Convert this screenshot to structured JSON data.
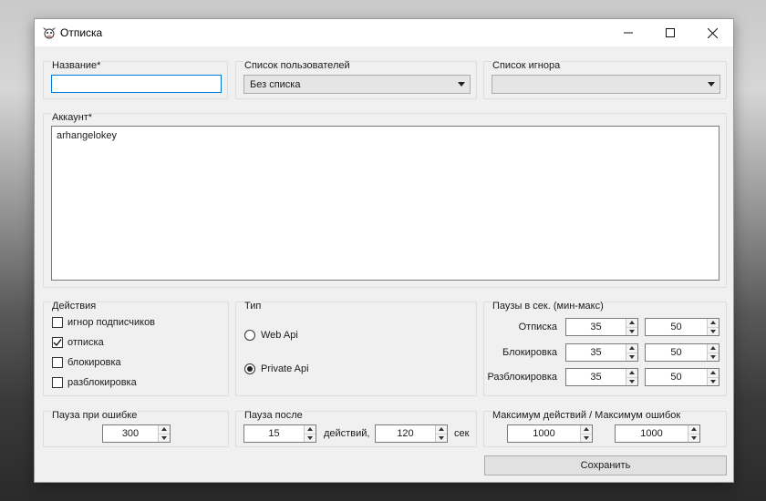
{
  "window": {
    "title": "Отписка",
    "icon": "cow-icon",
    "controls": {
      "minimize": "minimize-icon",
      "maximize": "maximize-icon",
      "close": "close-icon"
    }
  },
  "name_group": {
    "title": "Название*",
    "value": ""
  },
  "users_list_group": {
    "title": "Список пользователей",
    "selected": "Без списка"
  },
  "ignore_list_group": {
    "title": "Список игнора",
    "selected": ""
  },
  "account_group": {
    "title": "Аккаунт*",
    "value": "arhangelokey"
  },
  "actions_group": {
    "title": "Действия",
    "items": [
      {
        "label": "игнор подписчиков",
        "checked": false
      },
      {
        "label": "отписка",
        "checked": true
      },
      {
        "label": "блокировка",
        "checked": false
      },
      {
        "label": "разблокировка",
        "checked": false
      }
    ]
  },
  "type_group": {
    "title": "Тип",
    "options": [
      {
        "label": "Web Api",
        "selected": false
      },
      {
        "label": "Private Api",
        "selected": true
      }
    ]
  },
  "pauses_group": {
    "title": "Паузы в сек. (мин-макс)",
    "rows": [
      {
        "label": "Отписка",
        "min": "35",
        "max": "50"
      },
      {
        "label": "Блокировка",
        "min": "35",
        "max": "50"
      },
      {
        "label": "Разблокировка",
        "min": "35",
        "max": "50"
      }
    ]
  },
  "error_pause_group": {
    "title": "Пауза при ошибке",
    "value": "300"
  },
  "pause_after_group": {
    "title": "Пауза после",
    "actions_value": "15",
    "actions_label": "действий,",
    "seconds_value": "120",
    "seconds_label": "сек"
  },
  "max_group": {
    "title": "Максимум действий / Максимум ошибок",
    "max_actions": "1000",
    "max_errors": "1000"
  },
  "save_button": {
    "label": "Сохранить"
  }
}
